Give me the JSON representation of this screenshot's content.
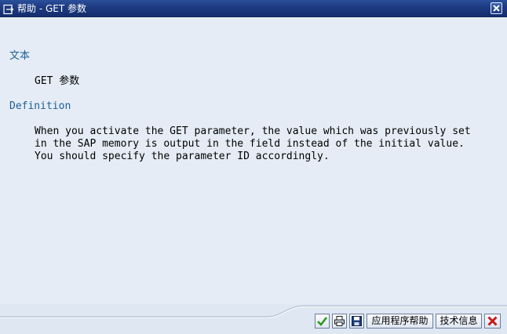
{
  "window": {
    "title": "帮助 - GET 参数",
    "icons": {
      "title": "help-window-icon",
      "close": "close-icon"
    }
  },
  "sections": [
    {
      "heading": "文本",
      "lines": [
        "GET 参数"
      ]
    },
    {
      "heading": "Definition",
      "lines": [
        "When you activate the GET parameter, the value which was previously set",
        "in the SAP memory is output in the field instead of the initial value.",
        "You should specify the parameter ID accordingly."
      ]
    }
  ],
  "toolbar": {
    "confirm_icon": "checkmark-icon",
    "print_icon": "print-icon",
    "save_icon": "save-icon",
    "app_help_label": "应用程序帮助",
    "tech_info_label": "技术信息",
    "cancel_icon": "cancel-icon"
  },
  "colors": {
    "titlebar": "#1d3a80",
    "background": "#e5ecf5",
    "heading": "#1d5f98",
    "confirm": "#2e9a1f",
    "cancel": "#c81b1b"
  }
}
